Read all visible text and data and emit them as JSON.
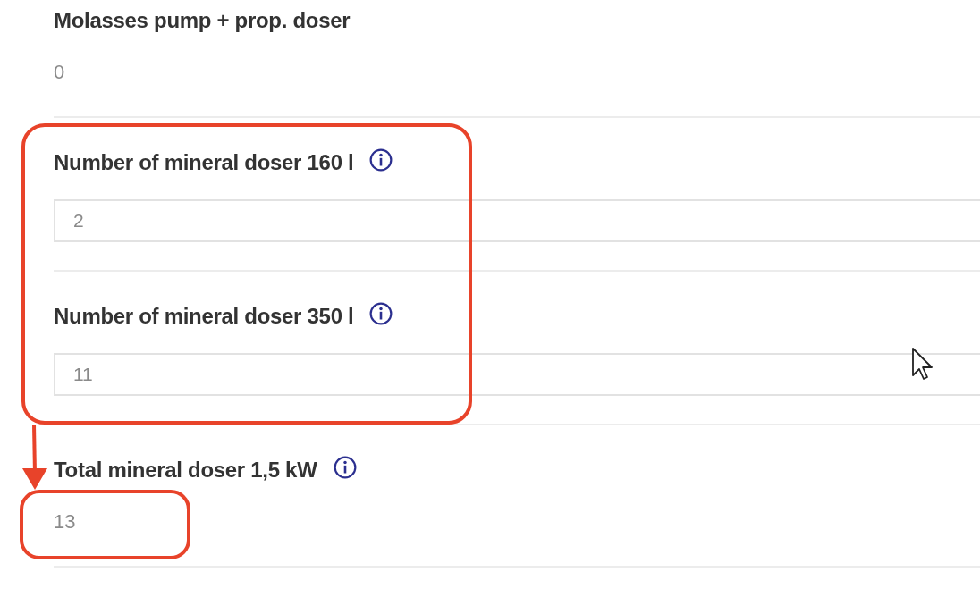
{
  "fields": [
    {
      "kind": "readonly",
      "label": "Molasses pump + prop. doser",
      "info": false,
      "value": "0"
    },
    {
      "kind": "input",
      "label": "Number of mineral doser 160 l",
      "info": true,
      "value": "2"
    },
    {
      "kind": "input",
      "label": "Number of mineral doser 350 l",
      "info": true,
      "value": "11"
    },
    {
      "kind": "readonly",
      "label": "Total mineral doser 1,5 kW",
      "info": true,
      "value": "13"
    }
  ]
}
